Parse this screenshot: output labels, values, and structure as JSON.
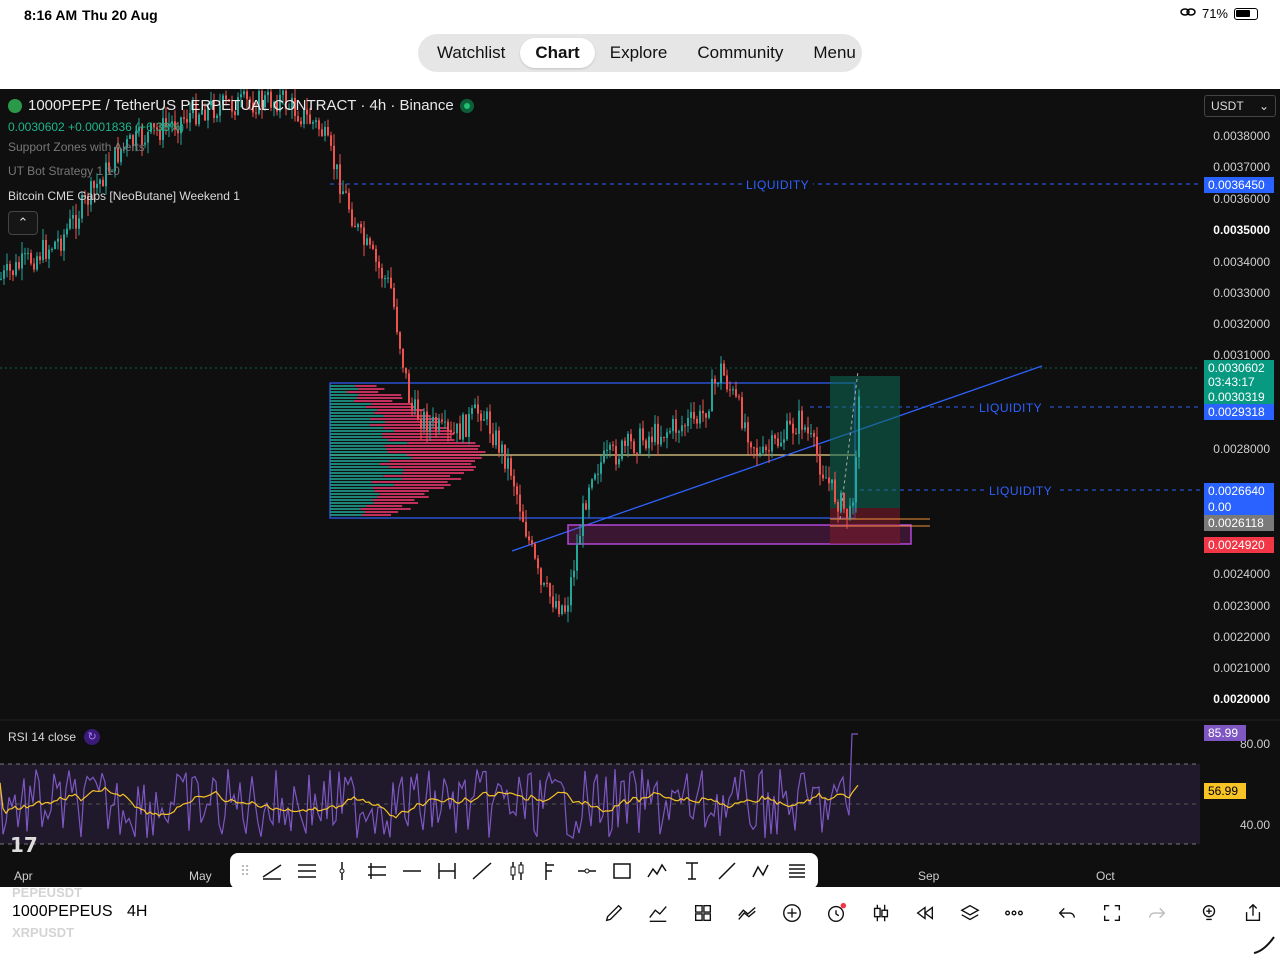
{
  "status_bar": {
    "time": "8:16 AM",
    "date": "Thu 20 Aug",
    "battery": "71%",
    "icons": [
      "link-icon",
      "battery-icon"
    ]
  },
  "nav": {
    "tabs": [
      {
        "label": "Watchlist",
        "active": false
      },
      {
        "label": "Chart",
        "active": true
      },
      {
        "label": "Explore",
        "active": false
      },
      {
        "label": "Community",
        "active": false
      },
      {
        "label": "Menu",
        "active": false
      }
    ]
  },
  "chart": {
    "title": "1000PEPE / TetherUS PERPETUAL CONTRACT · 4h · Binance",
    "price_line": "0.0030602  +0.0001836 (+6.38%)",
    "indicators": [
      "Support Zones with Alerts",
      "UT Bot Strategy 1 10",
      "Bitcoin CME Gaps [NeoButane]  Weekend  1"
    ],
    "currency": "USDT",
    "price_axis": [
      {
        "label": "0.0038000",
        "bold": false
      },
      {
        "label": "0.0037000",
        "bold": false
      },
      {
        "label": "0.0036000",
        "bold": false
      },
      {
        "label": "0.0035000",
        "bold": true
      },
      {
        "label": "0.0034000",
        "bold": false
      },
      {
        "label": "0.0033000",
        "bold": false
      },
      {
        "label": "0.0032000",
        "bold": false
      },
      {
        "label": "0.0031000",
        "bold": false
      },
      {
        "label": "0.0028000",
        "bold": false
      },
      {
        "label": "0.0024000",
        "bold": false
      },
      {
        "label": "0.0023000",
        "bold": false
      },
      {
        "label": "0.0022000",
        "bold": false
      },
      {
        "label": "0.0021000",
        "bold": false
      },
      {
        "label": "0.0020000",
        "bold": true
      }
    ],
    "price_tags": [
      {
        "label": "0.0036450",
        "color": "#2962ff"
      },
      {
        "label": "0.0030602",
        "color": "#089981"
      },
      {
        "label": "03:43:17",
        "color": "#089981"
      },
      {
        "label": "0.0030319",
        "color": "#089981"
      },
      {
        "label": "0.0029318",
        "color": "#2962ff"
      },
      {
        "label": "0.0026640",
        "color": "#2962ff"
      },
      {
        "label": "0.00",
        "color": "#2962ff"
      },
      {
        "label": "0.0026118",
        "color": "#7a7a7a"
      },
      {
        "label": "0.0024920",
        "color": "#f23645"
      }
    ],
    "liquidity_label": "LIQUIDITY",
    "time_axis": [
      "Apr",
      "May",
      "Sep",
      "Oct"
    ],
    "rsi": {
      "label": "RSI 14 close",
      "axis": [
        "80.00",
        "40.00"
      ],
      "value_tags": [
        {
          "label": "85.99",
          "color": "#7e57c2"
        },
        {
          "label": "56.99",
          "color": "#f7c325"
        }
      ]
    },
    "logo": "17"
  },
  "drawing_tools": [
    "trend-line-icon",
    "fib-retracement-icon",
    "vertical-line-icon",
    "horizontal-ray-icon",
    "horizontal-line-icon",
    "date-range-icon",
    "ray-icon",
    "bars-pattern-icon",
    "flag-icon",
    "cross-line-icon",
    "rectangle-icon",
    "elliott-wave-icon",
    "text-cursor-icon",
    "line-icon",
    "abc-pattern-icon",
    "fib-fan-icon"
  ],
  "bottom": {
    "symbol": "1000PEPEUSDT",
    "interval": "4H",
    "ghost_symbols": [
      "PEPEUSDT",
      "XRPUSDT"
    ],
    "tools": [
      "pen-icon",
      "indicators-icon",
      "layouts-icon",
      "compare-icon",
      "add-icon",
      "alert-icon",
      "candle-style-icon",
      "replay-icon",
      "layers-icon",
      "more-icon",
      "undo-icon",
      "fullscreen-icon",
      "redo-icon",
      "ideas-icon",
      "share-icon"
    ]
  }
}
